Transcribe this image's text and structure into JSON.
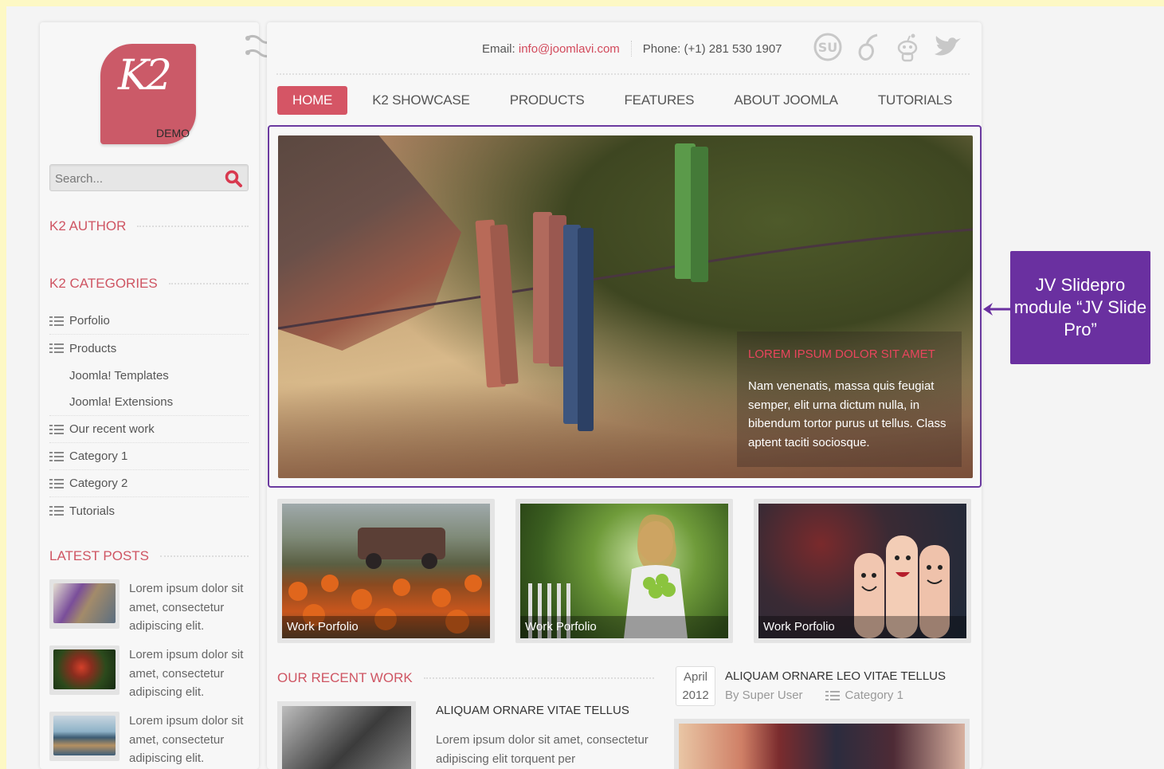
{
  "logo": {
    "mark": "K2",
    "sub": "DEMO"
  },
  "search": {
    "placeholder": "Search..."
  },
  "sidebar": {
    "author_heading": "K2 AUTHOR",
    "categories_heading": "K2 CATEGORIES",
    "categories": [
      {
        "label": "Porfolio",
        "icon": "list-icon"
      },
      {
        "label": "Products",
        "icon": "list-icon"
      },
      {
        "label": "Joomla! Templates",
        "sub": true
      },
      {
        "label": "Joomla! Extensions",
        "sub": true
      },
      {
        "label": "Our recent work",
        "icon": "list-icon"
      },
      {
        "label": "Category 1",
        "icon": "list-icon"
      },
      {
        "label": "Category 2",
        "icon": "list-icon"
      },
      {
        "label": "Tutorials",
        "icon": "list-icon"
      }
    ],
    "latest_heading": "LATEST POSTS",
    "posts": [
      {
        "text": "Lorem ipsum dolor sit amet, consectetur adipiscing elit."
      },
      {
        "text": "Lorem ipsum dolor sit amet, consectetur adipiscing elit."
      },
      {
        "text": "Lorem ipsum dolor sit amet, consectetur adipiscing elit."
      }
    ]
  },
  "header": {
    "email_label": "Email:",
    "email": "info@joomlavi.com",
    "phone_label": "Phone: (+1) 281 530 1907",
    "socials": [
      "stumbleupon-icon",
      "delicious-icon",
      "reddit-icon",
      "twitter-icon"
    ]
  },
  "nav": [
    "HOME",
    "K2 SHOWCASE",
    "PRODUCTS",
    "FEATURES",
    "ABOUT JOOMLA",
    "TUTORIALS"
  ],
  "slider": {
    "caption_title": "LOREM IPSUM DOLOR SIT AMET",
    "caption_text": "Nam venenatis, massa quis feugiat semper, elit urna dictum nulla, in bibendum tortor purus ut tellus. Class aptent taciti sociosque."
  },
  "callout": {
    "text": "JV Slidepro module “JV Slide Pro”"
  },
  "tiles": [
    {
      "label": "Work Porfolio"
    },
    {
      "label": "Work Porfolio"
    },
    {
      "label": "Work Porfolio"
    }
  ],
  "recent": {
    "heading": "OUR RECENT WORK",
    "title": "ALIQUAM ORNARE VITAE TELLUS",
    "excerpt": "Lorem ipsum dolor sit amet, consectetur adipiscing elit torquent per"
  },
  "article": {
    "month": "April",
    "year": "2012",
    "title": "ALIQUAM ORNARE LEO VITAE TELLUS",
    "author": "By Super User",
    "category": "Category 1"
  },
  "colors": {
    "accent": "#d55565",
    "callout": "#6a30a0",
    "background": "#fdf8c4"
  }
}
